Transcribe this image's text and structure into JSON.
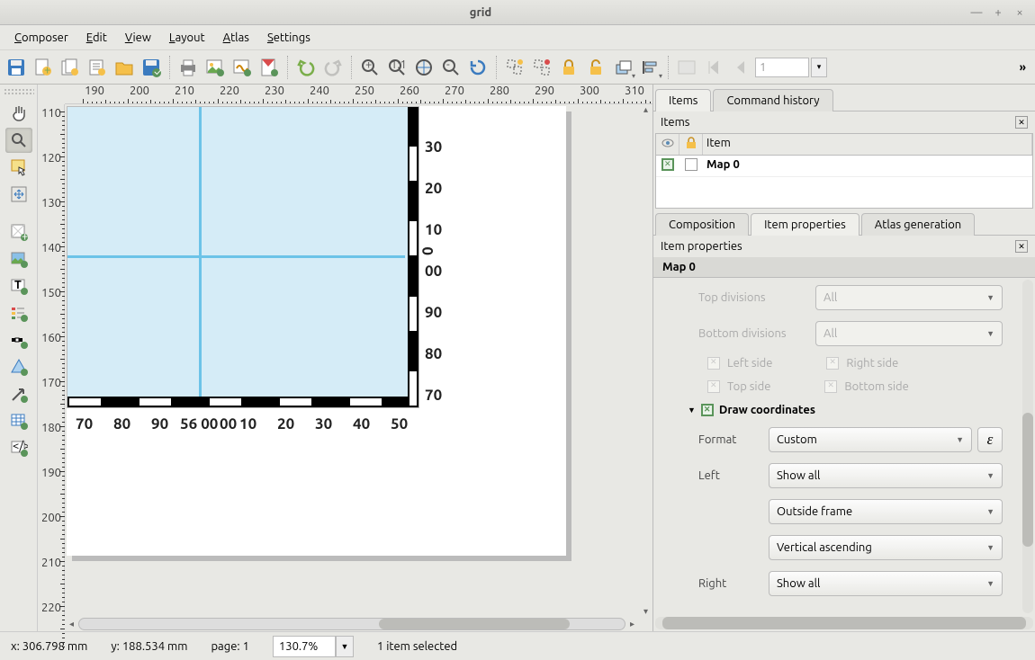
{
  "window": {
    "title": "grid"
  },
  "menubar": [
    "Composer",
    "Edit",
    "View",
    "Layout",
    "Atlas",
    "Settings"
  ],
  "atlas_page": "1",
  "left_tools": [
    {
      "name": "pan-tool-icon"
    },
    {
      "name": "zoom-tool-icon"
    },
    {
      "name": "select-tool-icon"
    },
    {
      "name": "move-content-tool-icon"
    },
    {
      "name": "add-map-tool-icon"
    },
    {
      "name": "add-image-tool-icon"
    },
    {
      "name": "add-label-tool-icon"
    },
    {
      "name": "add-legend-tool-icon"
    },
    {
      "name": "add-scalebar-tool-icon"
    },
    {
      "name": "add-shape-tool-icon"
    },
    {
      "name": "add-arrow-tool-icon"
    },
    {
      "name": "add-table-tool-icon"
    },
    {
      "name": "add-html-tool-icon"
    }
  ],
  "h_ruler": [
    190,
    200,
    210,
    220,
    230,
    240,
    250,
    260,
    270,
    280,
    290,
    300,
    310
  ],
  "v_ruler": [
    110,
    120,
    130,
    140,
    150,
    160,
    170,
    180,
    190,
    200,
    210,
    220
  ],
  "canvas": {
    "right_coords": [
      "30",
      "20",
      "10",
      "00",
      "90",
      "80",
      "70"
    ],
    "rot_coord": "0",
    "bottom_coords": [
      "70",
      "80",
      "90",
      "56 00",
      "00",
      "10",
      "20",
      "30",
      "40",
      "50"
    ]
  },
  "panel_tabs": {
    "items": "Items",
    "history": "Command history"
  },
  "items_panel": {
    "title": "Items",
    "col_item": "Item",
    "row0_name": "Map 0"
  },
  "prop_tabs": {
    "composition": "Composition",
    "item": "Item properties",
    "atlas": "Atlas generation"
  },
  "item_props": {
    "title": "Item properties",
    "section": "Map 0",
    "top_div_label": "Top divisions",
    "bottom_div_label": "Bottom divisions",
    "all": "All",
    "left_side": "Left side",
    "right_side": "Right side",
    "top_side": "Top side",
    "bottom_side": "Bottom side",
    "draw_coords": "Draw coordinates",
    "format_label": "Format",
    "format_value": "Custom",
    "left_label": "Left",
    "left_value": "Show all",
    "outside": "Outside frame",
    "vert_asc": "Vertical ascending",
    "right_label": "Right",
    "right_value": "Show all"
  },
  "status": {
    "x": "x: 306.798 mm",
    "y": "y: 188.534 mm",
    "page": "page: 1",
    "zoom": "130.7%",
    "sel": "1 item selected"
  }
}
